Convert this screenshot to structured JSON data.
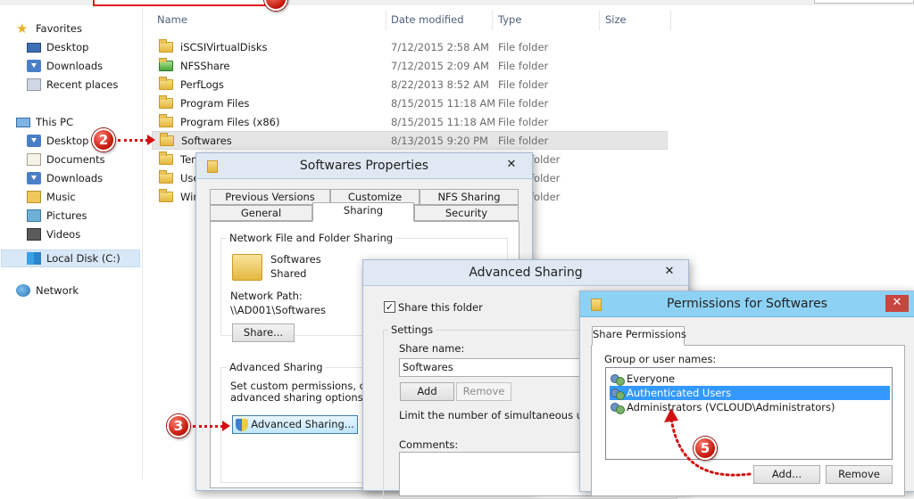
{
  "explorer": {
    "columns": {
      "name": "Name",
      "date": "Date modified",
      "type": "Type",
      "size": "Size"
    },
    "nav": {
      "favorites": "Favorites",
      "fav_items": [
        "Desktop",
        "Downloads",
        "Recent places"
      ],
      "this_pc": "This PC",
      "pc_items": [
        "Desktop",
        "Documents",
        "Downloads",
        "Music",
        "Pictures",
        "Videos",
        "Local Disk (C:)"
      ],
      "network": "Network"
    },
    "files": [
      {
        "name": "iSCSIVirtualDisks",
        "date": "7/12/2015 2:58 AM",
        "type": "File folder"
      },
      {
        "name": "NFSShare",
        "date": "7/12/2015 2:09 AM",
        "type": "File folder"
      },
      {
        "name": "PerfLogs",
        "date": "8/22/2013 8:52 AM",
        "type": "File folder"
      },
      {
        "name": "Program Files",
        "date": "8/15/2015 11:18 AM",
        "type": "File folder"
      },
      {
        "name": "Program Files (x86)",
        "date": "8/15/2015 11:18 AM",
        "type": "File folder"
      },
      {
        "name": "Softwares",
        "date": "8/13/2015 9:20 PM",
        "type": "File folder"
      },
      {
        "name": "Tem",
        "date": "",
        "type": "folder"
      },
      {
        "name": "User",
        "date": "",
        "type": "folder"
      },
      {
        "name": "Win",
        "date": "",
        "type": "folder"
      }
    ]
  },
  "callouts": {
    "two": "2",
    "three": "3",
    "five": "5"
  },
  "properties": {
    "title": "Softwares Properties",
    "close": "✕",
    "tabs_row1": [
      "Previous Versions",
      "Customize",
      "NFS Sharing"
    ],
    "tabs_row2": [
      "General",
      "Sharing",
      "Security"
    ],
    "nffs_label": "Network File and Folder Sharing",
    "folder_name": "Softwares",
    "folder_state": "Shared",
    "network_path_label": "Network Path:",
    "network_path": "\\\\AD001\\Softwares",
    "share_button": "Share...",
    "adv_label": "Advanced Sharing",
    "adv_desc_1": "Set custom permissions, create",
    "adv_desc_2": "advanced sharing options.",
    "adv_button": "Advanced Sharing..."
  },
  "advanced": {
    "title": "Advanced Sharing",
    "close": "✕",
    "share_checkbox": "Share this folder",
    "checked": "✓",
    "settings_label": "Settings",
    "share_name_label": "Share name:",
    "share_name_value": "Softwares",
    "add_button": "Add",
    "remove_button": "Remove",
    "limit_label": "Limit the number of simultaneous users to:",
    "comments_label": "Comments:"
  },
  "permissions": {
    "title": "Permissions for Softwares",
    "close": "✕",
    "tab": "Share Permissions",
    "group_label": "Group or user names:",
    "users": [
      "Everyone",
      "Authenticated Users",
      "Administrators (VCLOUD\\Administrators)"
    ],
    "selected_index": 1,
    "add_button": "Add...",
    "remove_button": "Remove"
  }
}
